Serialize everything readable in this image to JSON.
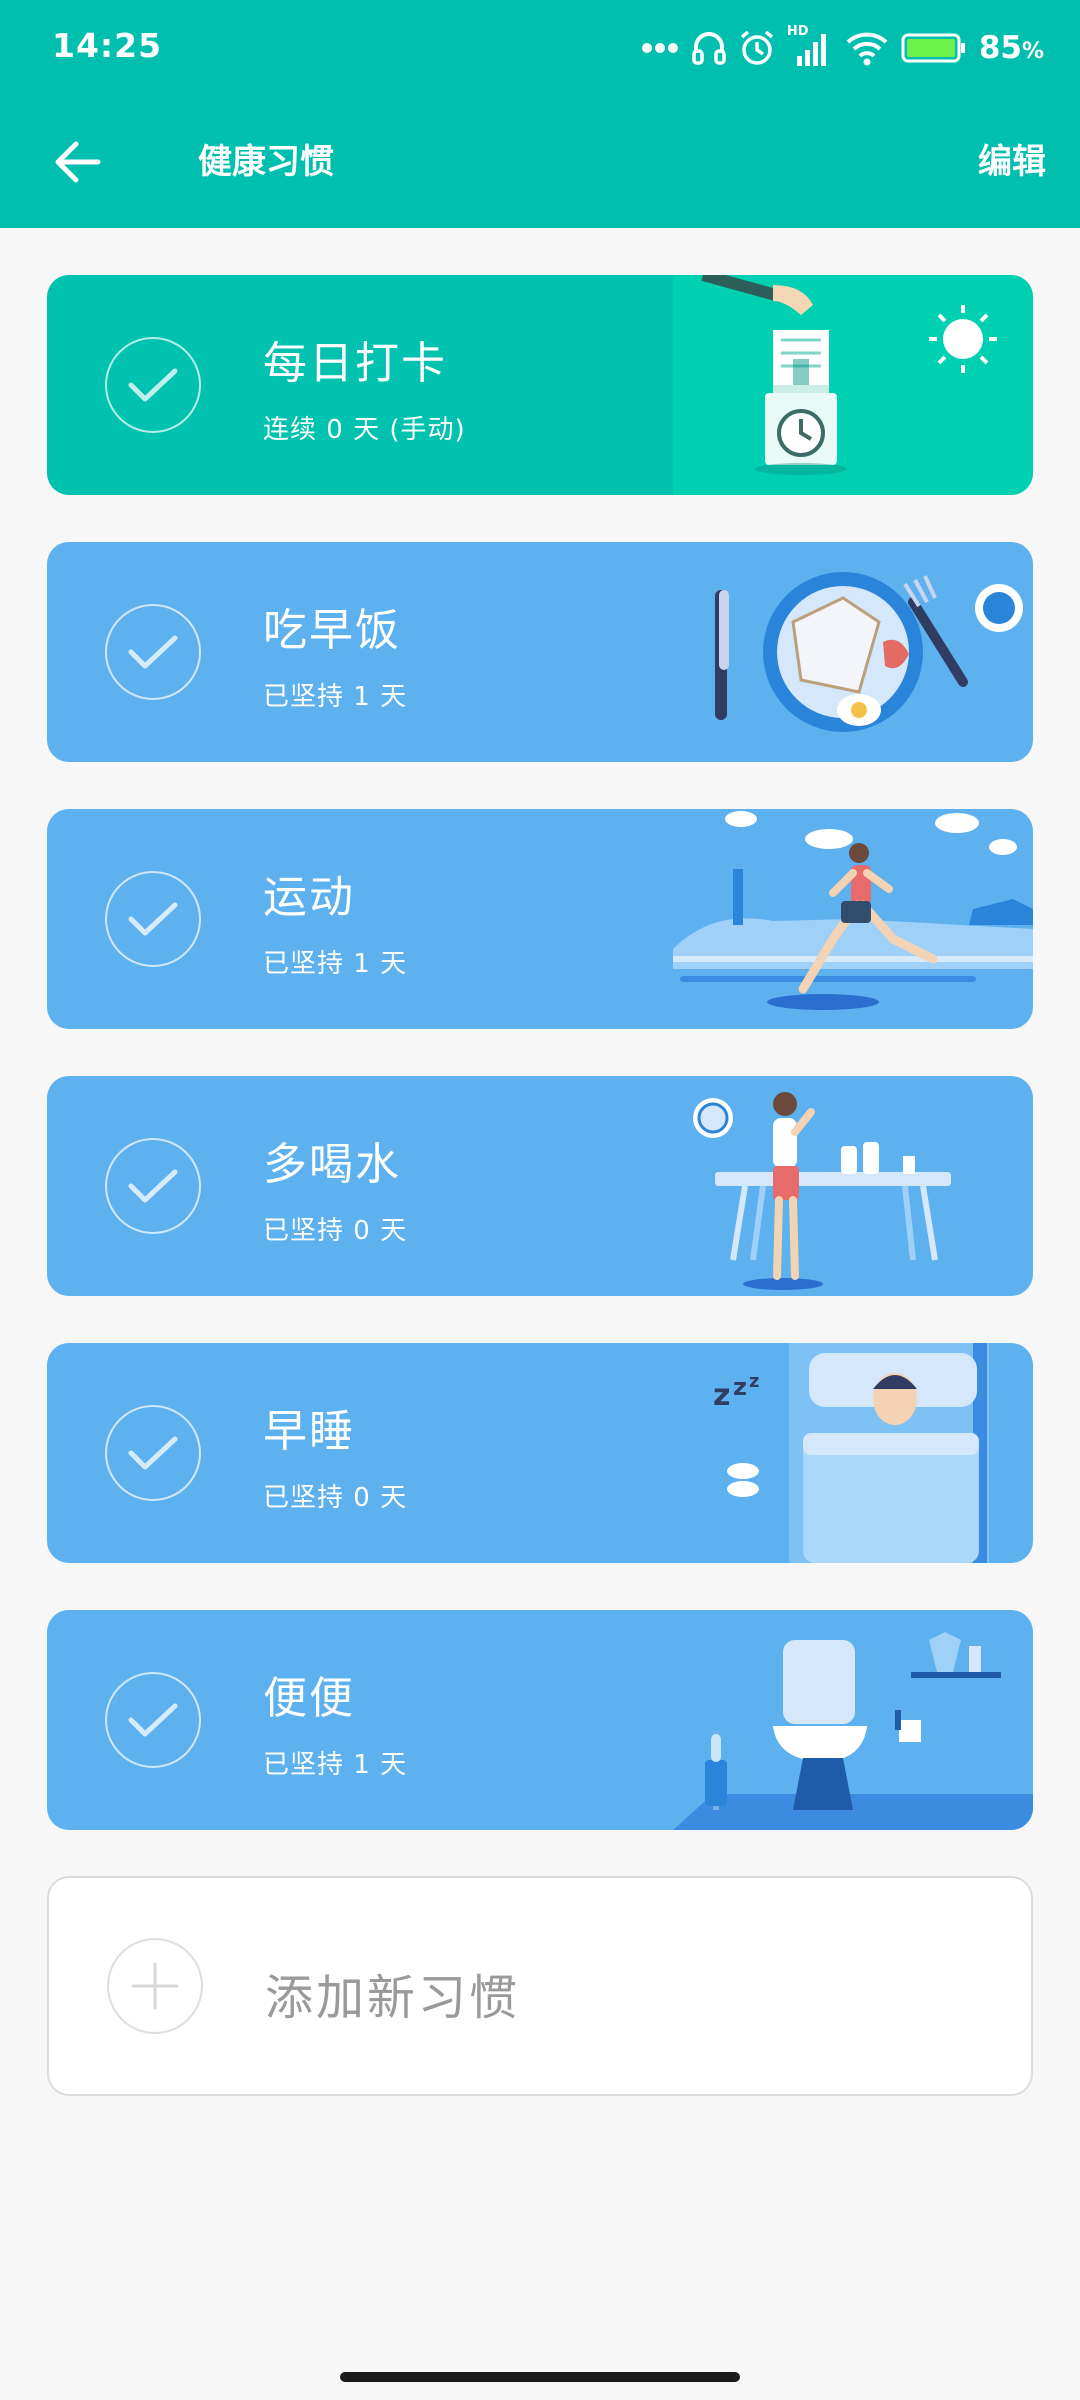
{
  "status_bar": {
    "time": "14:25",
    "network_label": "HD",
    "battery_percent": "85",
    "battery_unit": "%",
    "icons": [
      "more-dots-icon",
      "headset-icon",
      "alarm-icon",
      "signal-icon",
      "wifi-icon",
      "battery-icon"
    ]
  },
  "app_bar": {
    "title": "健康习惯",
    "edit_label": "编辑"
  },
  "colors": {
    "primary": "#00bfae",
    "card_teal": "#00c2af",
    "card_blue": "#5eb1ef",
    "background": "#f7f7f7"
  },
  "habits": [
    {
      "name": "每日打卡",
      "subtitle": "连续 0 天 (手动)",
      "illustration": "punch-clock-illustration"
    },
    {
      "name": "吃早饭",
      "subtitle": "已坚持 1 天",
      "illustration": "breakfast-illustration"
    },
    {
      "name": "运动",
      "subtitle": "已坚持 1 天",
      "illustration": "running-illustration"
    },
    {
      "name": "多喝水",
      "subtitle": "已坚持 0 天",
      "illustration": "drinking-water-illustration"
    },
    {
      "name": "早睡",
      "subtitle": "已坚持 0 天",
      "illustration": "sleeping-illustration"
    },
    {
      "name": "便便",
      "subtitle": "已坚持 1 天",
      "illustration": "toilet-illustration"
    }
  ],
  "add_habit": {
    "label": "添加新习惯"
  }
}
